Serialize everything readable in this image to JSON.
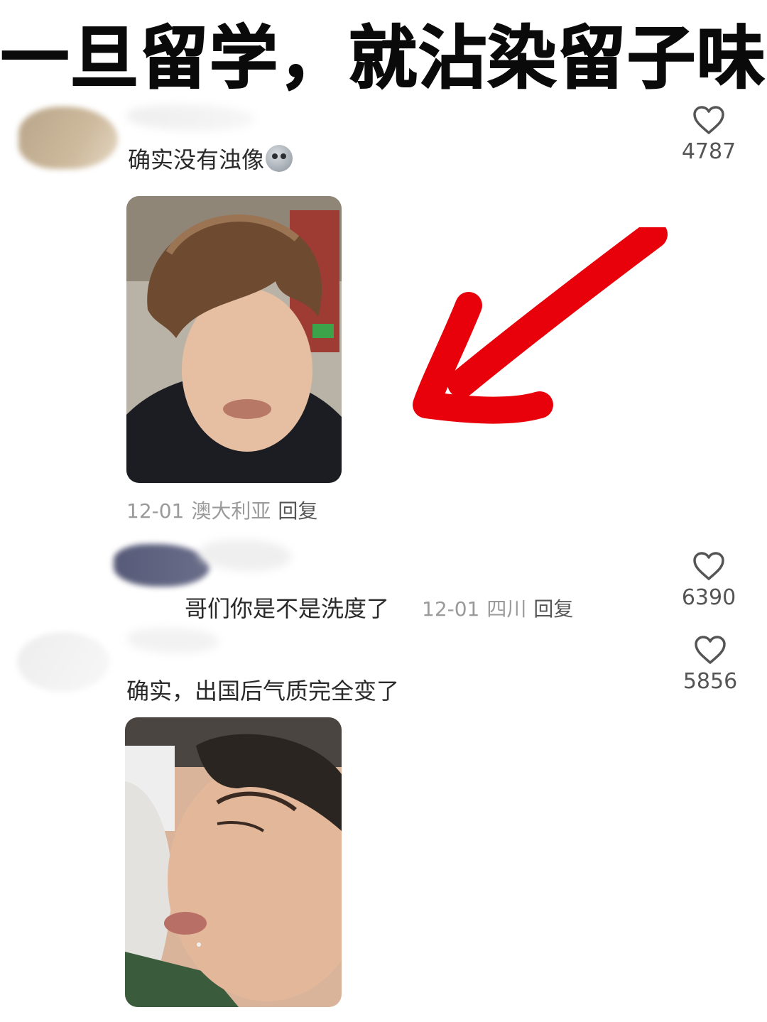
{
  "headline": "一旦留学，就沾染留子味",
  "comments": [
    {
      "text": "确实没有浊像",
      "emoji": "ghost-emoji",
      "likes": "4787",
      "meta": {
        "date": "12-01",
        "location": "澳大利亚",
        "reply": "回复"
      }
    },
    {
      "text": "哥们你是不是洗度了",
      "likes": "6390",
      "meta": {
        "date": "12-01",
        "location": "四川",
        "reply": "回复"
      }
    },
    {
      "text": "确实，出国后气质完全变了",
      "likes": "5856"
    }
  ],
  "icons": {
    "like": "heart-outline-icon",
    "annotation": "red-arrow-icon"
  },
  "colors": {
    "arrow": "#e8000a",
    "meta_text": "#9a9a9a",
    "heart": "#555555"
  }
}
